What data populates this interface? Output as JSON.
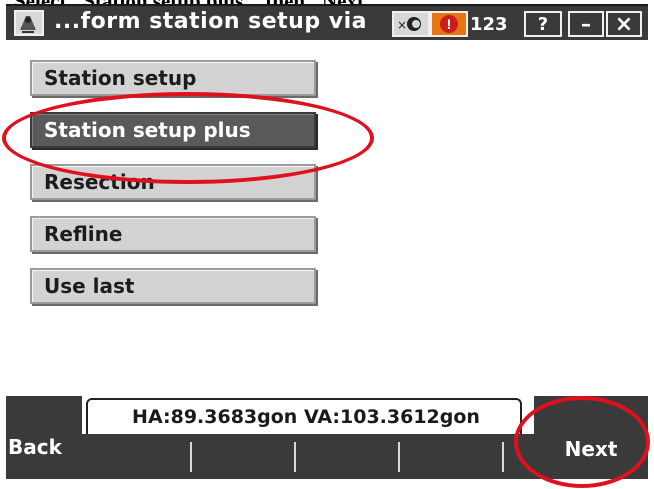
{
  "caption": "Select \"Station setup plus\", then \"Next\"",
  "window": {
    "title": "...form station setup via",
    "status_number": "123",
    "help_label": "?",
    "minimize_label": "–",
    "close_label": "×",
    "alert_glyph": "!"
  },
  "menu": {
    "items": [
      {
        "label": "Station setup",
        "selected": false
      },
      {
        "label": "Station setup plus",
        "selected": true
      },
      {
        "label": "Resection",
        "selected": false
      },
      {
        "label": "Refline",
        "selected": false
      },
      {
        "label": "Use last",
        "selected": false
      }
    ]
  },
  "status_bar": {
    "readout": "HA:89.3683gon  VA:103.3612gon"
  },
  "buttons": {
    "back": "Back",
    "next": "Next"
  },
  "colors": {
    "highlight": "#e0101c",
    "selected": "#5a5a5a",
    "warning": "#e87511"
  }
}
